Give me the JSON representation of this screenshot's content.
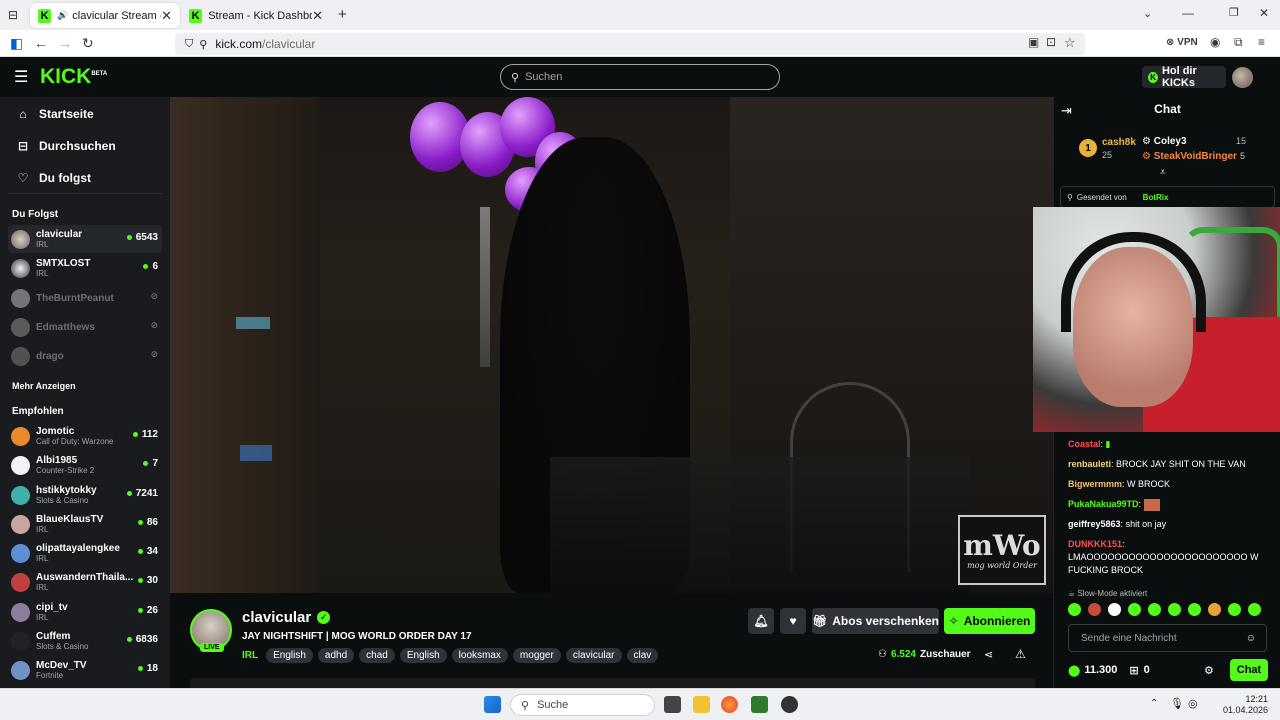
{
  "browser": {
    "tabs": [
      {
        "title": "clavicular Stream - Watch L",
        "active": true
      },
      {
        "title": "Stream - Kick Dashboard",
        "active": false
      }
    ],
    "url": "kick.com/clavicular",
    "url_host": "kick.com",
    "url_path": "/clavicular",
    "vpn_label": "VPN",
    "new_tab": "+"
  },
  "header": {
    "logo": "KICK",
    "logo_badge": "BETA",
    "search_placeholder": "Suchen",
    "get_kicks": "Hol dir KICKs"
  },
  "sidebar": {
    "nav": [
      {
        "label": "Startseite",
        "icon": "home-icon"
      },
      {
        "label": "Durchsuchen",
        "icon": "browse-icon"
      },
      {
        "label": "Du folgst",
        "icon": "heart-icon"
      }
    ],
    "following_title": "Du Folgst",
    "following": [
      {
        "name": "clavicular",
        "category": "IRL",
        "viewers": "6543",
        "live": true
      },
      {
        "name": "SMTXLOST",
        "category": "IRL",
        "viewers": "6",
        "live": true
      },
      {
        "name": "TheBurntPeanut",
        "category": "",
        "viewers": "",
        "live": false
      },
      {
        "name": "Edmatthews",
        "category": "",
        "viewers": "",
        "live": false
      },
      {
        "name": "drago",
        "category": "",
        "viewers": "",
        "live": false
      }
    ],
    "show_more": "Mehr Anzeigen",
    "recommended_title": "Empfohlen",
    "recommended": [
      {
        "name": "Jomotic",
        "category": "Call of Duty: Warzone",
        "viewers": "112"
      },
      {
        "name": "Albi1985",
        "category": "Counter-Strike 2",
        "viewers": "7"
      },
      {
        "name": "hstikkytokky",
        "category": "Slots & Casino",
        "viewers": "7241"
      },
      {
        "name": "BlaueKlausTV",
        "category": "IRL",
        "viewers": "86"
      },
      {
        "name": "olipattayalengkee",
        "category": "IRL",
        "viewers": "34"
      },
      {
        "name": "AuswandernThaila...",
        "category": "IRL",
        "viewers": "30"
      },
      {
        "name": "cipi_tv",
        "category": "IRL",
        "viewers": "26"
      },
      {
        "name": "Cuffem",
        "category": "Slots & Casino",
        "viewers": "6836"
      },
      {
        "name": "McDev_TV",
        "category": "Fortnite",
        "viewers": "18"
      }
    ]
  },
  "video": {
    "overlay_logo": "mWo",
    "overlay_text": "mog world Order"
  },
  "stream": {
    "streamer": "clavicular",
    "live_badge": "LIVE",
    "title": "JAY NIGHTSHIFT | MOG WORLD ORDER DAY 17",
    "category": "IRL",
    "tags": [
      "English",
      "adhd",
      "chad",
      "English",
      "looksmax",
      "mogger",
      "clavicular",
      "clav"
    ],
    "gift_subs": "Abos verschenken",
    "subscribe": "Abonnieren",
    "viewers": "6.524",
    "viewers_label": "Zuschauer"
  },
  "chat": {
    "title": "Chat",
    "leaderboard": {
      "first_rank": "1",
      "first_name": "cash8k",
      "first_count": "25",
      "second_name": "Coley3",
      "second_count": "15",
      "third_name": "SteakVoidBringer",
      "third_count": "5"
    },
    "pinned": {
      "label": "Gesendet von",
      "bot": "BotRix"
    },
    "messages": [
      {
        "user": "Coastal",
        "text": "",
        "color": "#ff4d5e"
      },
      {
        "user": "renbauleti",
        "text": "BROCK JAY SHIT ON THE VAN",
        "color": "#f5d76e"
      },
      {
        "user": "Bigwermmm",
        "text": "W BROCK",
        "color": "#f5c26b"
      },
      {
        "user": "PukaNakua99TD",
        "text": "",
        "color": "#53fc18"
      },
      {
        "user": "geiffrey5863",
        "text": "shit on jay",
        "color": "#ffffff"
      },
      {
        "user": "DUNKKK151",
        "text": "LMAOOOOOOOOOOOOOOOOOOOOOOO W FUCKING BROCK",
        "color": "#ff4d5e"
      }
    ],
    "slow_mode": "Slow-Mode aktiviert",
    "input_placeholder": "Sende eine Nachricht",
    "kicks_balance": "11.300",
    "gift_count": "0",
    "send_button": "Chat"
  },
  "taskbar": {
    "search": "Suche",
    "time": "12:21",
    "date": "01.04.2026"
  },
  "colors": {
    "brand": "#53fc18",
    "background": "#0b0e0f",
    "sidebar": "#191b1f"
  }
}
